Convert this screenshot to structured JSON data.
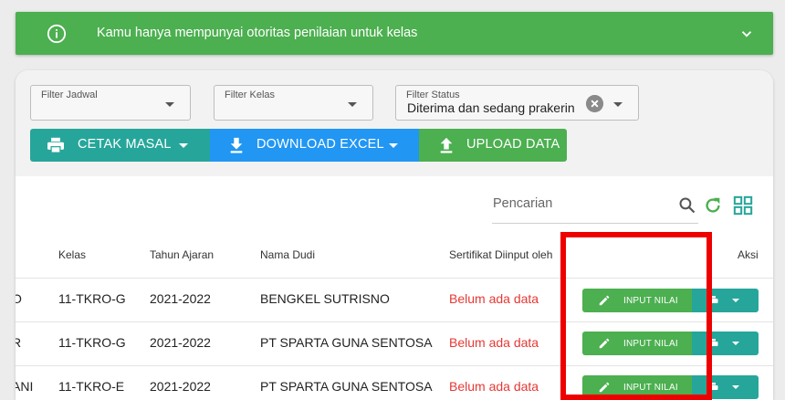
{
  "alert": {
    "message": "Kamu hanya mempunyai otoritas penilaian untuk kelas",
    "color": "#4caf50"
  },
  "filters": {
    "jadwal": {
      "label": "Filter Jadwal",
      "value": ""
    },
    "kelas": {
      "label": "Filter Kelas",
      "value": ""
    },
    "status": {
      "label": "Filter Status",
      "value": "Diterima dan sedang prakerin"
    }
  },
  "toolbar": {
    "cetak_label": "CETAK MASAL",
    "download_label": "DOWNLOAD EXCEL",
    "upload_label": "UPLOAD DATA",
    "colors": {
      "cetak": "#26a69a",
      "download": "#2196f3",
      "upload": "#4caf50"
    }
  },
  "search": {
    "placeholder": "Pencarian"
  },
  "table": {
    "headers": {
      "kelas": "Kelas",
      "tahun": "Tahun Ajaran",
      "dudi": "Nama Dudi",
      "sertifikat": "Sertifikat Diinput oleh",
      "aksi": "Aksi"
    },
    "rows": [
      {
        "nama": "O",
        "kelas": "11-TKRO-G",
        "tahun": "2021-2022",
        "dudi": "BENGKEL SUTRISNO",
        "sertifikat": "Belum ada data",
        "action": "INPUT NILAI"
      },
      {
        "nama": "R",
        "kelas": "11-TKRO-G",
        "tahun": "2021-2022",
        "dudi": "PT SPARTA GUNA SENTOSA",
        "sertifikat": "Belum ada data",
        "action": "INPUT NILAI"
      },
      {
        "nama": "ANI",
        "kelas": "11-TKRO-E",
        "tahun": "2021-2022",
        "dudi": "PT SPARTA GUNA SENTOSA",
        "sertifikat": "Belum ada data",
        "action": "INPUT NILAI"
      }
    ]
  }
}
